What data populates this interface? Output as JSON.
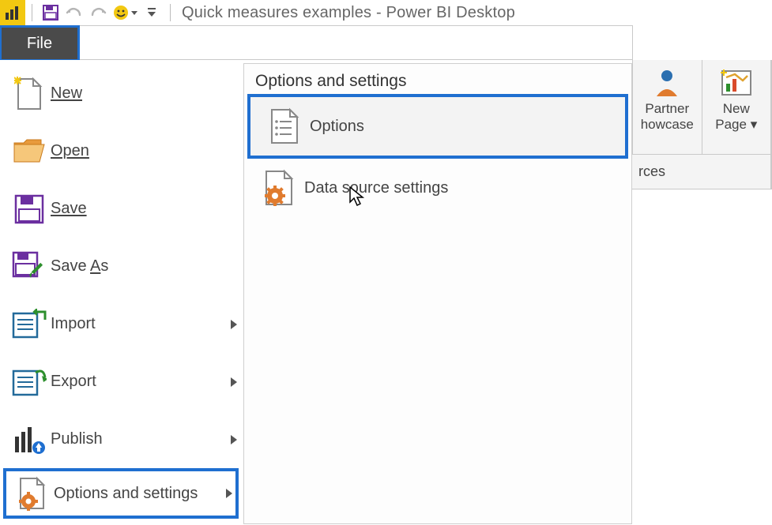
{
  "titlebar": {
    "app_title": "Quick measures examples - Power BI Desktop"
  },
  "file_tab_label": "File",
  "file_menu": [
    {
      "key": "new",
      "label": "New",
      "accel_index": 0,
      "has_sub": false,
      "icon": "new-doc-icon"
    },
    {
      "key": "open",
      "label": "Open",
      "accel_index": 0,
      "has_sub": false,
      "icon": "open-folder-icon"
    },
    {
      "key": "save",
      "label": "Save",
      "accel_index": 0,
      "has_sub": false,
      "icon": "save-icon"
    },
    {
      "key": "saveas",
      "label": "Save As",
      "accel_index": 5,
      "has_sub": false,
      "icon": "save-as-icon"
    },
    {
      "key": "import",
      "label": "Import",
      "accel_index": -1,
      "has_sub": true,
      "icon": "import-icon"
    },
    {
      "key": "export",
      "label": "Export",
      "accel_index": -1,
      "has_sub": true,
      "icon": "export-icon"
    },
    {
      "key": "publish",
      "label": "Publish",
      "accel_index": -1,
      "has_sub": true,
      "icon": "publish-icon"
    },
    {
      "key": "options",
      "label": "Options and settings",
      "accel_index": -1,
      "has_sub": true,
      "icon": "options-gear-doc-icon",
      "selected": true
    }
  ],
  "sub_panel": {
    "title": "Options and settings",
    "items": [
      {
        "key": "options",
        "label": "Options",
        "icon": "options-list-doc-icon",
        "highlighted": true
      },
      {
        "key": "data_source_settings",
        "label": "Data source settings",
        "icon": "data-source-settings-icon",
        "highlighted": false
      }
    ]
  },
  "ribbon_right": {
    "btn1": {
      "line1": "Partner",
      "line2": "howcase"
    },
    "btn2": {
      "line1": "New",
      "line2": "Page ▾"
    },
    "lower_text": "rces"
  }
}
